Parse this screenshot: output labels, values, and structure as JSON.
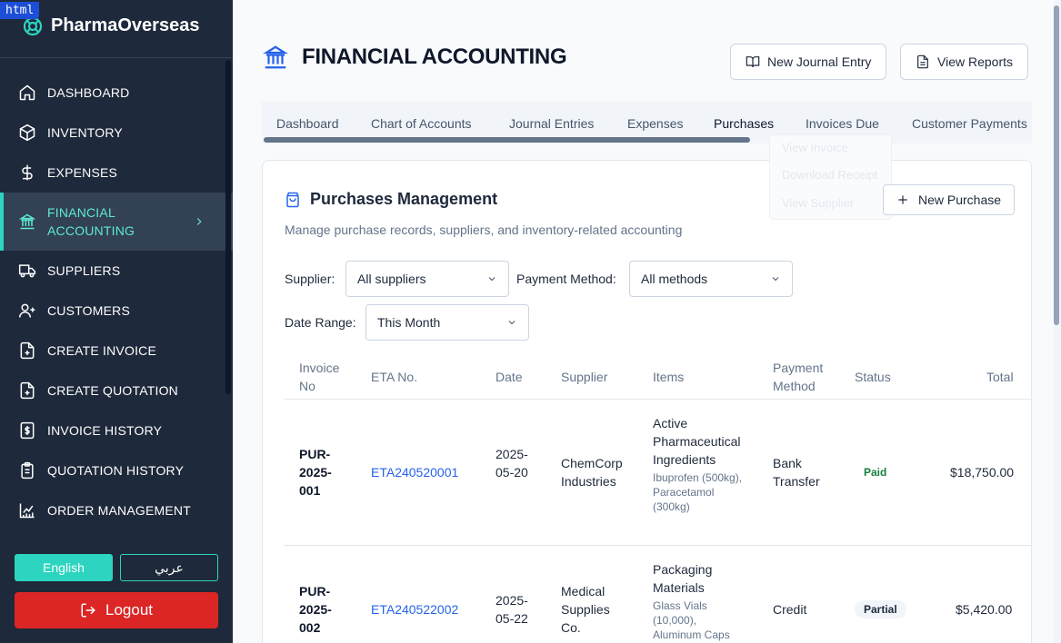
{
  "badge": "html",
  "brand": {
    "name": "PharmaOverseas"
  },
  "sidebar": {
    "items": [
      {
        "label": "DASHBOARD",
        "icon": "home-icon"
      },
      {
        "label": "INVENTORY",
        "icon": "box-icon"
      },
      {
        "label": "EXPENSES",
        "icon": "dollar-icon"
      },
      {
        "label": "FINANCIAL ACCOUNTING",
        "icon": "bank-icon",
        "active": true
      },
      {
        "label": "SUPPLIERS",
        "icon": "truck-icon"
      },
      {
        "label": "CUSTOMERS",
        "icon": "user-plus-icon"
      },
      {
        "label": "CREATE INVOICE",
        "icon": "file-plus-icon"
      },
      {
        "label": "CREATE QUOTATION",
        "icon": "file-plus-icon"
      },
      {
        "label": "INVOICE HISTORY",
        "icon": "file-dollar-icon"
      },
      {
        "label": "QUOTATION HISTORY",
        "icon": "clipboard-icon"
      },
      {
        "label": "ORDER MANAGEMENT",
        "icon": "chart-icon"
      }
    ],
    "lang_en": "English",
    "lang_ar": "عربي",
    "logout": "Logout"
  },
  "header": {
    "title": "FINANCIAL ACCOUNTING",
    "new_journal": "New Journal Entry",
    "view_reports": "View Reports"
  },
  "tabs": [
    "Dashboard",
    "Chart of Accounts",
    "Journal Entries",
    "Expenses",
    "Purchases",
    "Invoices Due",
    "Customer Payments"
  ],
  "ghost_menu": [
    "View Invoice",
    "Download Receipt",
    "View Supplier"
  ],
  "card": {
    "title": "Purchases Management",
    "description": "Manage purchase records, suppliers, and inventory-related accounting",
    "new_purchase": "New Purchase"
  },
  "filters": {
    "supplier_label": "Supplier:",
    "supplier_value": "All suppliers",
    "payment_label": "Payment Method:",
    "payment_value": "All methods",
    "date_label": "Date Range:",
    "date_value": "This Month"
  },
  "table": {
    "headers": [
      "Invoice No",
      "ETA No.",
      "Date",
      "Supplier",
      "Items",
      "Payment Method",
      "Status",
      "Total"
    ],
    "rows": [
      {
        "invoice": "PUR-2025-001",
        "eta": "ETA240520001",
        "date": "2025-05-20",
        "supplier": "ChemCorp Industries",
        "item": "Active Pharmaceutical Ingredients",
        "item_sub": "Ibuprofen (500kg), Paracetamol (300kg)",
        "payment": "Bank Transfer",
        "status": "Paid",
        "total": "$18,750.00"
      },
      {
        "invoice": "PUR-2025-002",
        "eta": "ETA240522002",
        "date": "2025-05-22",
        "supplier": "Medical Supplies Co.",
        "item": "Packaging Materials",
        "item_sub": "Glass Vials (10,000), Aluminum Caps",
        "payment": "Credit",
        "status": "Partial",
        "total": "$5,420.00"
      }
    ]
  }
}
